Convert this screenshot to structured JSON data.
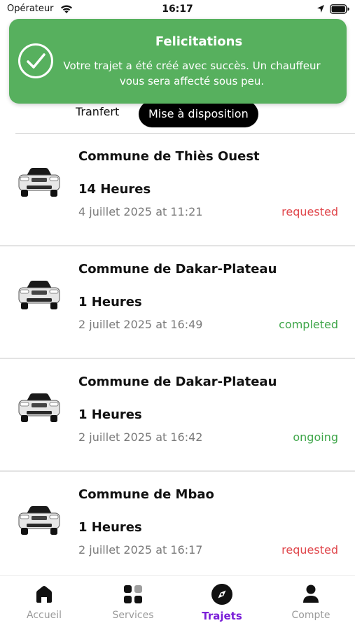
{
  "status_bar": {
    "carrier": "Opérateur",
    "time": "16:17"
  },
  "toast": {
    "title": "Felicitations",
    "message": "Votre trajet a été créé avec succès. Un chauffeur vous sera affecté sous peu.",
    "color": "#57b05e"
  },
  "segments": {
    "transfer_label": "Tranfert",
    "mise_label": "Mise à  disposition",
    "selected": "Mise à  disposition"
  },
  "trips": [
    {
      "place": "Commune de Thiès Ouest",
      "duration": "14 Heures",
      "date": "4 juillet 2025 at 11:21",
      "status": "requested",
      "status_color": "#e0474c"
    },
    {
      "place": "Commune de Dakar-Plateau",
      "duration": "1 Heures",
      "date": "2 juillet 2025 at 16:49",
      "status": "completed",
      "status_color": "#3fa64a"
    },
    {
      "place": "Commune de Dakar-Plateau",
      "duration": "1 Heures",
      "date": "2 juillet 2025 at 16:42",
      "status": "ongoing",
      "status_color": "#3fa64a"
    },
    {
      "place": "Commune de Mbao",
      "duration": "1 Heures",
      "date": "2 juillet 2025 at 16:17",
      "status": "requested",
      "status_color": "#e0474c"
    }
  ],
  "bottom_nav": {
    "items": [
      {
        "label": "Accueil",
        "icon": "home-icon"
      },
      {
        "label": "Services",
        "icon": "grid-icon"
      },
      {
        "label": "Trajets",
        "icon": "compass-icon"
      },
      {
        "label": "Compte",
        "icon": "person-icon"
      }
    ],
    "active": "Trajets",
    "active_color": "#7b1fd8"
  }
}
